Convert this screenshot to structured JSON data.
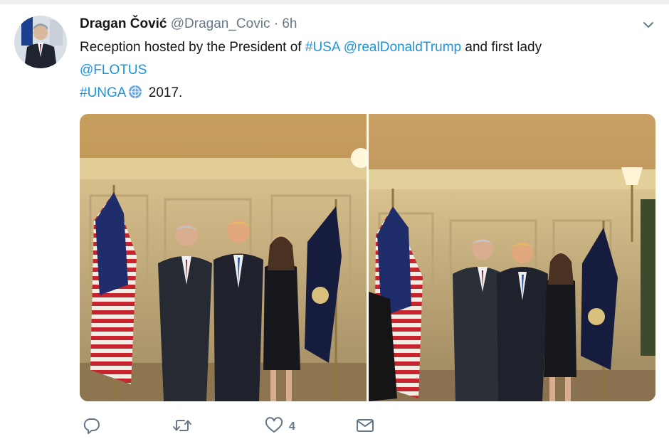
{
  "tweet": {
    "display_name": "Dragan Čović",
    "handle": "@Dragan_Covic",
    "separator": "·",
    "time": "6h",
    "text_part1": "Reception hosted by the President of ",
    "hashtag_usa": "#USA",
    "space1": " ",
    "mention_trump": "@realDonaldTrump",
    "text_part2": " and first lady",
    "mention_flotus": "@FLOTUS",
    "hashtag_unga": "#UNGA",
    "year_text": " 2017."
  },
  "actions": {
    "reply_count": "",
    "retweet_count": "",
    "like_count": "4"
  },
  "colors": {
    "link": "#1b95e0",
    "icon": "#657786",
    "wall": "#c9a66b"
  },
  "icons": [
    "chevron-down-icon",
    "un-globe-emoji",
    "reply-icon",
    "retweet-icon",
    "heart-icon",
    "envelope-icon"
  ]
}
